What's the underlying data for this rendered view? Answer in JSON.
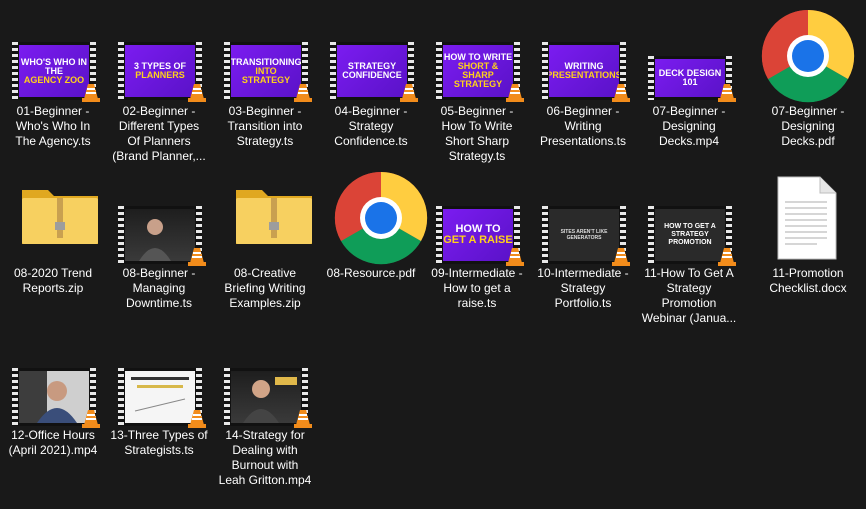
{
  "files": [
    {
      "label": "01-Beginner -\nWho's Who In\nThe Agency.ts",
      "kind": "video",
      "thumb_text": "WHO'S WHO IN THE",
      "thumb_accent": "AGENCY ZOO"
    },
    {
      "label": "02-Beginner -\nDifferent Types\nOf Planners\n(Brand Planner,...",
      "kind": "video",
      "thumb_text": "3 TYPES OF",
      "thumb_accent": "PLANNERS"
    },
    {
      "label": "03-Beginner -\nTransition into\nStrategy.ts",
      "kind": "video",
      "thumb_text": "TRANSITIONING",
      "thumb_accent": "INTO STRATEGY"
    },
    {
      "label": "04-Beginner -\nStrategy\nConfidence.ts",
      "kind": "video",
      "thumb_text": "STRATEGY CONFIDENCE",
      "thumb_accent": ""
    },
    {
      "label": "05-Beginner -\nHow To Write\nShort Sharp\nStrategy.ts",
      "kind": "video",
      "thumb_text": "HOW TO WRITE",
      "thumb_accent": "SHORT & SHARP STRATEGY"
    },
    {
      "label": "06-Beginner -\nWriting\nPresentations.ts",
      "kind": "video",
      "thumb_text": "WRITING",
      "thumb_accent": "PRESENTATIONS"
    },
    {
      "label": "07-Beginner -\nDesigning\nDecks.mp4",
      "kind": "video",
      "thumb_text": "DECK DESIGN 101",
      "thumb_accent": ""
    },
    {
      "label": "07-Beginner -\nDesigning\nDecks.pdf",
      "kind": "pdf"
    },
    {
      "label": "08-2020 Trend\nReports.zip",
      "kind": "zip"
    },
    {
      "label": "08-Beginner -\nManaging\nDowntime.ts",
      "kind": "video-photo"
    },
    {
      "label": "08-Creative\nBriefing Writing\nExamples.zip",
      "kind": "zip"
    },
    {
      "label": "08-Resource.pdf",
      "kind": "pdf"
    },
    {
      "label": "09-Intermediate -\nHow to get a\nraise.ts",
      "kind": "video",
      "thumb_text": "HOW TO",
      "thumb_accent": "GET A RAISE"
    },
    {
      "label": "10-Intermediate -\nStrategy\nPortfolio.ts",
      "kind": "video-dark",
      "thumb_text": "SITES AREN'T LIKE GENERATORS",
      "thumb_accent": ""
    },
    {
      "label": "11-How To Get A\nStrategy\nPromotion\nWebinar (Janua...",
      "kind": "video-dark",
      "thumb_text": "HOW TO GET A STRATEGY PROMOTION",
      "thumb_accent": ""
    },
    {
      "label": "11-Promotion\nChecklist.docx",
      "kind": "docx"
    },
    {
      "label": "12-Office Hours\n(April 2021).mp4",
      "kind": "video-photo"
    },
    {
      "label": "13-Three Types of\nStrategists.ts",
      "kind": "video-slide"
    },
    {
      "label": "14-Strategy for\nDealing with\nBurnout with\nLeah Gritton.mp4",
      "kind": "video-photo"
    }
  ],
  "icons": {
    "vlc": "vlc-cone-icon",
    "chrome": "chrome-pdf-icon",
    "zip": "zip-folder-icon",
    "doc": "document-icon"
  },
  "colors": {
    "background": "#191919",
    "thumb_purple": "#7b1cf0",
    "thumb_yellow": "#ffd21a",
    "folder": "#f2c94c",
    "vlc_orange": "#f28c1b"
  }
}
